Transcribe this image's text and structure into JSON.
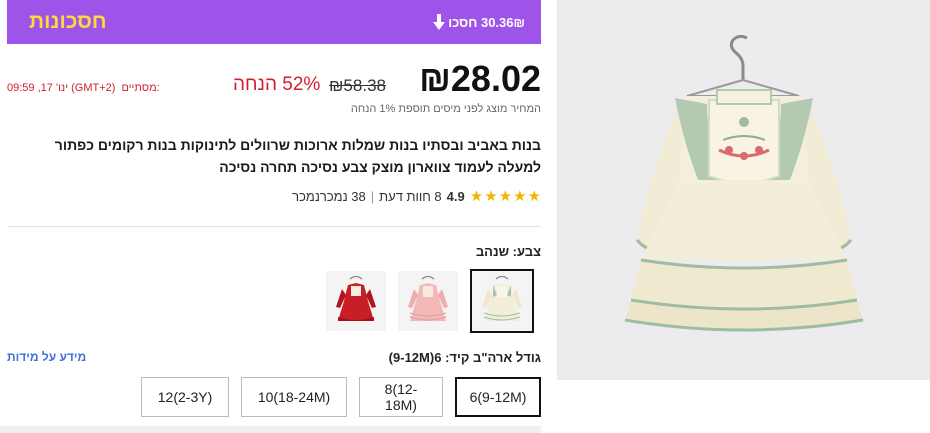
{
  "banner": {
    "title": "חסכונות",
    "savings_text": "30.36₪ חסכו",
    "bg_color": "#9e54e8",
    "title_color": "#ffd83c"
  },
  "price": {
    "current": "₪28.02",
    "original": "₪58.38",
    "discount": "52% הנחה",
    "timer_label": "מסתיים:",
    "timer_value": "ינו' 17, 09:59 (GMT+2)",
    "tax_note": "המחיר מוצג לפני מיסים תוספת 1% הנחה",
    "discount_color": "#d41c2c"
  },
  "product": {
    "title": "בנות באביב ובסתיו בנות שמלות ארוכות שרוולים לתינוקות בנות רקומים כפתור למעלה לעמוד צווארון מוצק צבע נסיכה תחרה נסיכה"
  },
  "rating": {
    "value": "4.9",
    "reviews": "8 חוות דעת",
    "sold": "38 נמכרנמכר",
    "stars": 5
  },
  "color": {
    "label": "צבע: שנהב",
    "options": [
      {
        "name": "ivory",
        "selected": true
      },
      {
        "name": "pink",
        "selected": false
      },
      {
        "name": "red",
        "selected": false
      }
    ]
  },
  "size": {
    "label": "גודל ארה\"ב קיד: 6(9-12M)",
    "guide": "מידע על מידות",
    "options": [
      "6(9-12M)",
      "8(12-18M)",
      "10(18-24M)",
      "12(2-3Y)"
    ],
    "selected_index": 0
  }
}
